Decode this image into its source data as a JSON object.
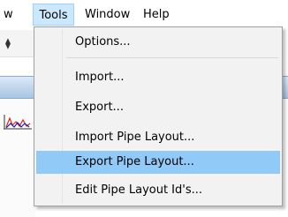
{
  "menubar": {
    "items": [
      {
        "label": "w"
      },
      {
        "label": "Tools"
      },
      {
        "label": "Window"
      },
      {
        "label": "Help"
      }
    ]
  },
  "toolbar": {
    "glyph": "⧫"
  },
  "tools_menu": {
    "items": [
      {
        "label": "Options..."
      },
      {
        "label": "Import..."
      },
      {
        "label": "Export..."
      },
      {
        "label": "Import Pipe Layout..."
      },
      {
        "label": "Export Pipe Layout..."
      },
      {
        "label": "Edit Pipe Layout Id's..."
      }
    ],
    "highlighted": "Export Pipe Layout..."
  },
  "colors": {
    "menu_bg": "#f2f2f2",
    "highlight": "#91c9f7",
    "menubar_active": "#cce8ff"
  }
}
